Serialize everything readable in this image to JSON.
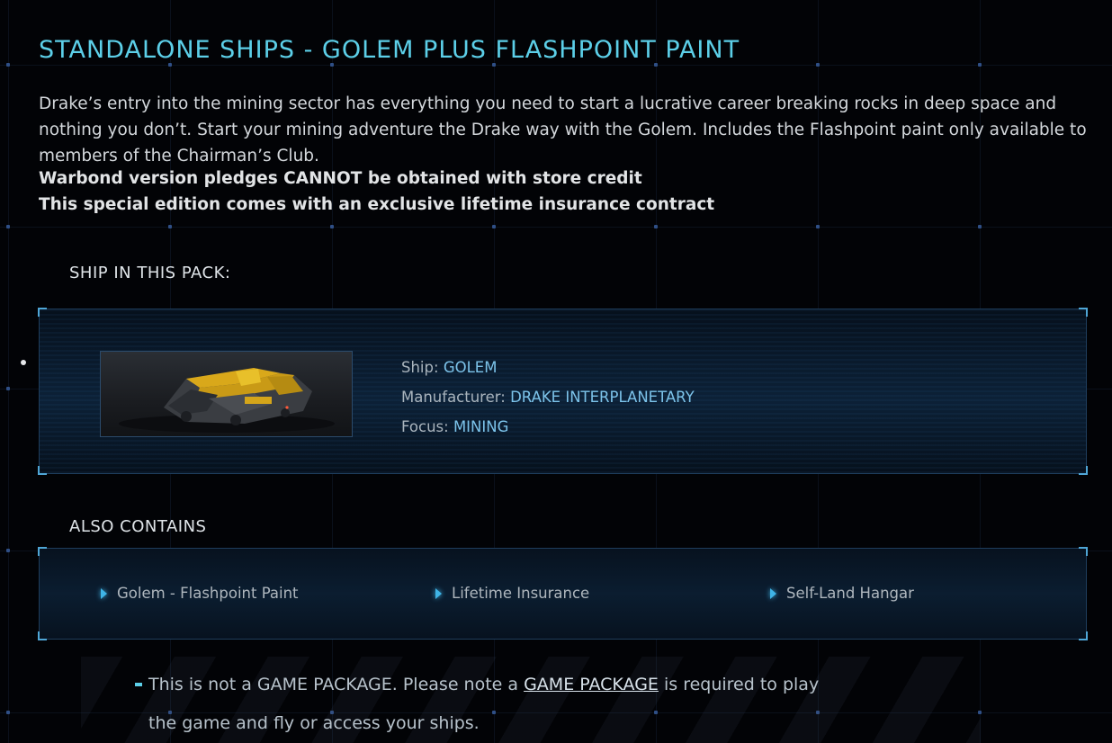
{
  "title": "STANDALONE SHIPS - GOLEM PLUS FLASHPOINT PAINT",
  "description": "Drake’s entry into the mining sector has everything you need to start a lucrative career breaking rocks in deep space and nothing you don’t. Start your mining adventure the Drake way with the Golem. Includes the Flashpoint paint only available to members of the Chairman’s Club.",
  "notice_1": "Warbond version pledges CANNOT be obtained with store credit",
  "notice_2": "This special edition comes with an exclusive lifetime insurance contract",
  "ship_section": {
    "heading": "SHIP IN THIS PACK:",
    "ship_label": "Ship:",
    "ship_value": "GOLEM",
    "manufacturer_label": "Manufacturer:",
    "manufacturer_value": "DRAKE INTERPLANETARY",
    "focus_label": "Focus:",
    "focus_value": "MINING"
  },
  "also_contains": {
    "heading": "ALSO CONTAINS",
    "items": [
      "Golem - Flashpoint Paint",
      "Lifetime Insurance",
      "Self-Land Hangar"
    ]
  },
  "note": {
    "prefix": "This is not a GAME PACKAGE. Please note a ",
    "link": "GAME PACKAGE",
    "suffix": " is required to play the game and fly or access your ships."
  },
  "colors": {
    "accent": "#5ccfe8",
    "value": "#7cc3ea",
    "ship_yellow": "#e3b51c"
  }
}
